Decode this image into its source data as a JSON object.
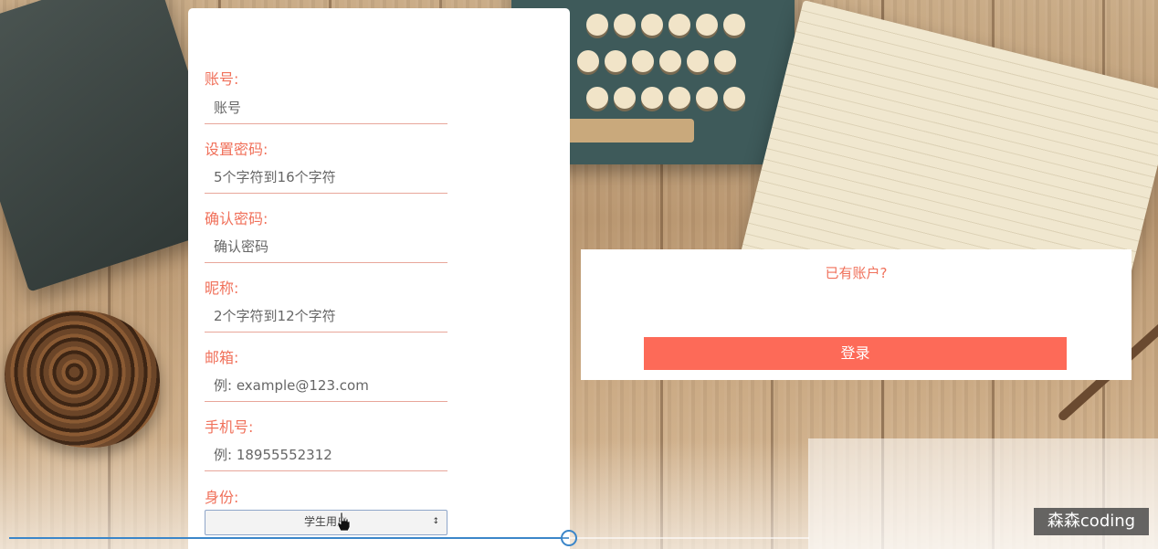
{
  "register_form": {
    "fields": [
      {
        "label": "账号:",
        "placeholder": "账号"
      },
      {
        "label": "设置密码:",
        "placeholder": "5个字符到16个字符"
      },
      {
        "label": "确认密码:",
        "placeholder": "确认密码"
      },
      {
        "label": "昵称:",
        "placeholder": "2个字符到12个字符"
      },
      {
        "label": "邮箱:",
        "placeholder": "例: example@123.com"
      },
      {
        "label": "手机号:",
        "placeholder": "例: 18955552312"
      }
    ],
    "identity": {
      "label": "身份:",
      "selected": "学生用户"
    }
  },
  "login_prompt": {
    "text": "已有账户?",
    "button_label": "登录"
  },
  "video_player": {
    "progress_fraction": 0.7
  },
  "watermark": "森森coding",
  "colors": {
    "accent": "#f0705a",
    "button": "#fd6a58",
    "progress": "#3b86c9"
  }
}
